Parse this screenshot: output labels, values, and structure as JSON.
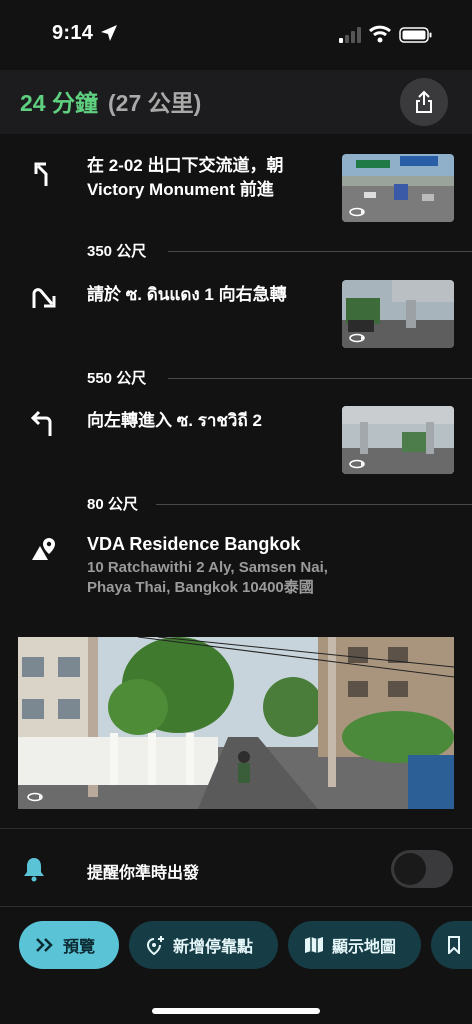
{
  "status_bar": {
    "time": "9:14"
  },
  "header": {
    "eta_time": "24 分鐘",
    "eta_distance": "(27 公里)",
    "share_icon": "share-icon"
  },
  "steps": [
    {
      "icon": "turn-slight-left-icon",
      "text": "在 2-02 出口下交流道，朝 Victory Monument 前進",
      "distance_after": "350 公尺"
    },
    {
      "icon": "turn-sharp-right-icon",
      "text": "請於 ซ. ดินแดง 1 向右急轉",
      "distance_after": "550 公尺"
    },
    {
      "icon": "turn-left-icon",
      "text": "向左轉進入 ซ. ราชวิถี 2",
      "distance_after": "80 公尺"
    }
  ],
  "destination": {
    "icon": "destination-pin-icon",
    "name": "VDA Residence Bangkok",
    "address": "10 Ratchawithi 2 Aly, Samsen Nai, Phaya Thai, Bangkok 10400泰國"
  },
  "reminder": {
    "label": "提醒你準時出發",
    "enabled": false
  },
  "bottom_actions": [
    {
      "icon": "chevrons-right-icon",
      "label": "預覽"
    },
    {
      "icon": "add-stop-icon",
      "label": "新增停靠點"
    },
    {
      "icon": "map-icon",
      "label": "顯示地圖"
    },
    {
      "icon": "bookmark-icon",
      "label": ""
    }
  ],
  "colors": {
    "eta_green": "#5fd07f",
    "accent_teal": "#5bc3d6",
    "pill_dark": "#163c45",
    "background": "#121212"
  }
}
